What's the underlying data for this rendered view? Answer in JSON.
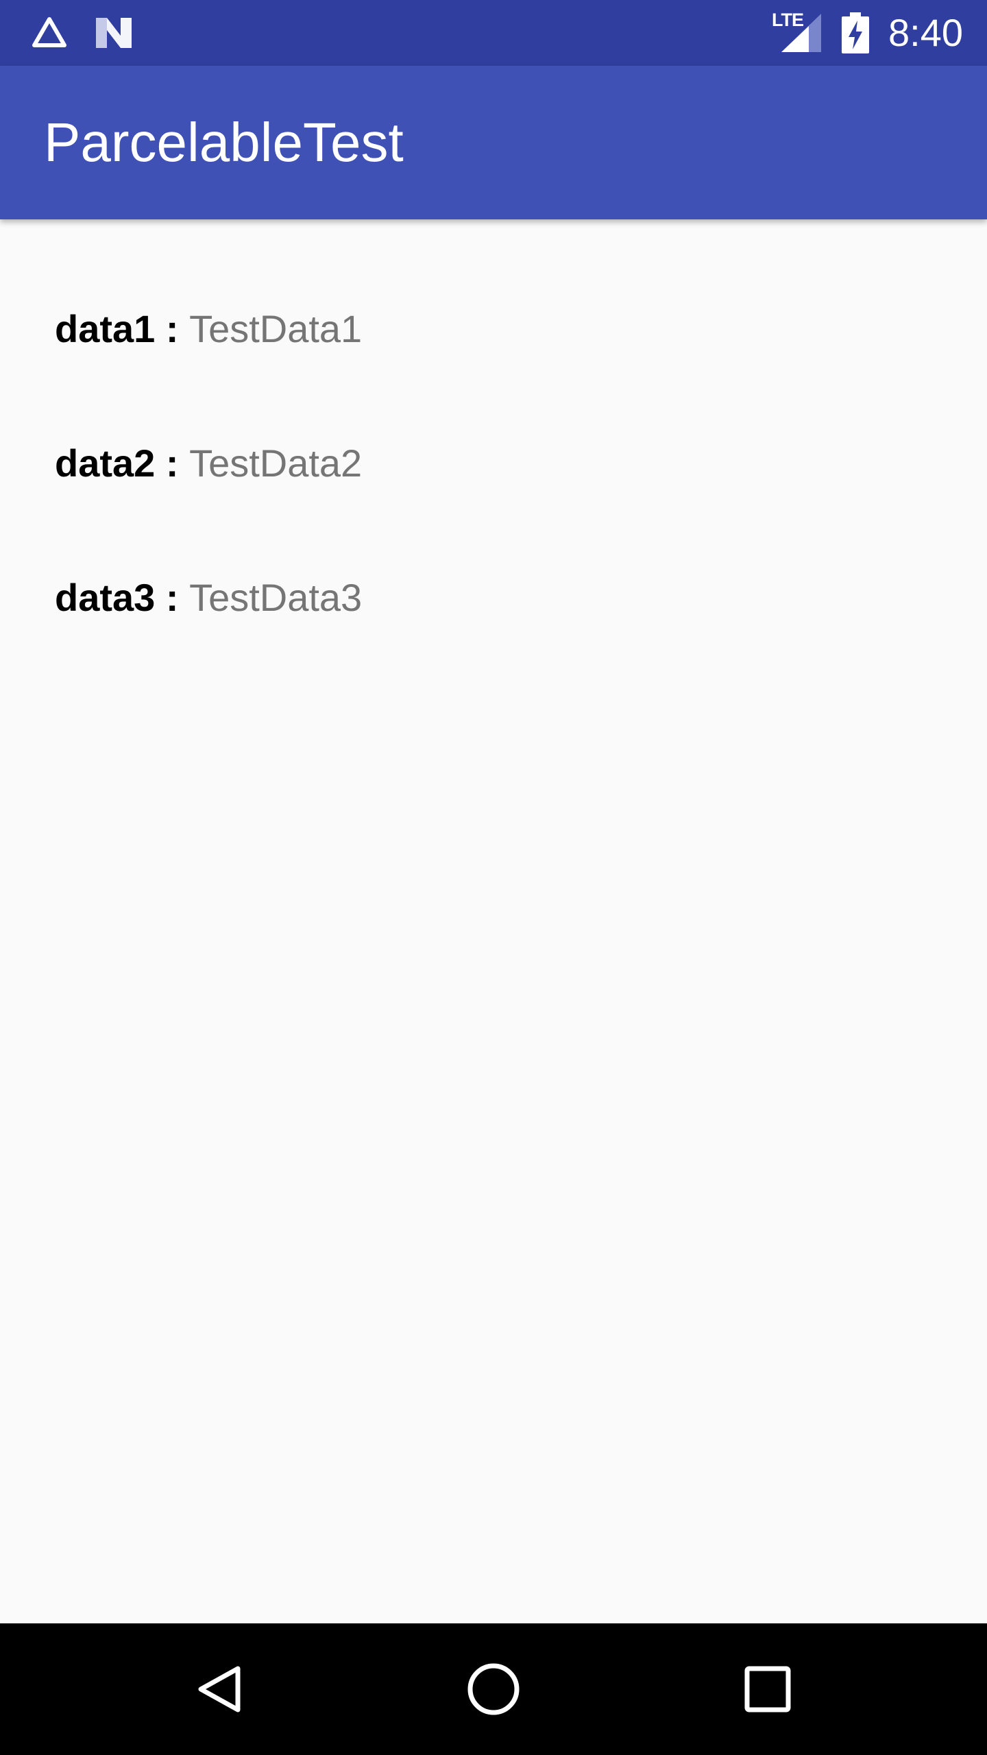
{
  "status_bar": {
    "time": "8:40",
    "network_label": "LTE",
    "notification_icons": [
      "drive-triangle-icon",
      "n-logo-icon"
    ]
  },
  "app_bar": {
    "title": "ParcelableTest"
  },
  "rows": [
    {
      "key": "data1",
      "separator": " : ",
      "value": "TestData1"
    },
    {
      "key": "data2",
      "separator": " : ",
      "value": "TestData2"
    },
    {
      "key": "data3",
      "separator": " : ",
      "value": "TestData3"
    }
  ],
  "nav_bar": {
    "buttons": [
      "back-icon",
      "home-icon",
      "recents-icon"
    ]
  },
  "colors": {
    "status_bar": "#303f9f",
    "app_bar": "#3f51b5",
    "background": "#fafafa",
    "value_text": "#757575"
  }
}
